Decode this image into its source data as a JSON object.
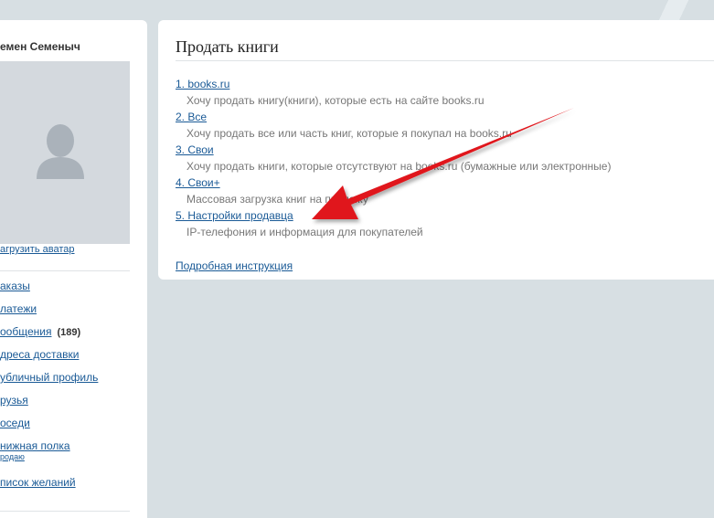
{
  "sidebar": {
    "user_name": "емен Семеныч",
    "avatar_link": "агрузить аватар",
    "nav": [
      {
        "label": "аказы"
      },
      {
        "label": "латежи"
      },
      {
        "label": "ообщения",
        "count": "(189)"
      },
      {
        "label": "дреса доставки"
      },
      {
        "label": "убличный профиль"
      },
      {
        "label": "рузья"
      },
      {
        "label": "оседи"
      },
      {
        "label": "нижная полка",
        "sub": "родаю"
      },
      {
        "label": "писок желаний"
      }
    ]
  },
  "main": {
    "title": "Продать книги",
    "options": [
      {
        "link": "1. books.ru",
        "desc": "Хочу продать книгу(книги), которые есть на сайте books.ru"
      },
      {
        "link": "2. Все",
        "desc": "Хочу продать все или часть книг, которые я покупал на books.ru"
      },
      {
        "link": "3. Свои",
        "desc": "Хочу продать книги, которые отсутствуют на books.ru (бумажные или электронные)"
      },
      {
        "link": "4. Свои+",
        "desc": "Массовая загрузка книг на продажу"
      },
      {
        "link": "5. Настройки продавца",
        "desc": "IP-телефония и информация для покупателей"
      }
    ],
    "instruction_link": "Подробная инструкция"
  },
  "colors": {
    "link": "#1a5a96",
    "page_bg": "#d7dfe3",
    "arrow": "#e0191f"
  },
  "icons": {
    "avatar": "user-silhouette-icon",
    "annotation": "red-arrow"
  }
}
